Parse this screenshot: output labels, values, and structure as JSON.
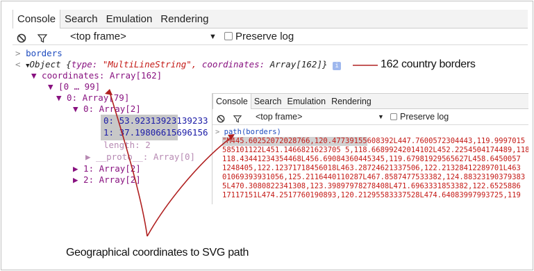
{
  "devtools": {
    "tabs": [
      "Console",
      "Search",
      "Emulation",
      "Rendering"
    ],
    "active_tab": "Console",
    "toolbar": {
      "block_icon": "block-icon",
      "filter_icon": "filter-icon",
      "frame_select": "<top frame>",
      "dropdown_icon": "▼",
      "preserve_log_label": "Preserve log"
    },
    "console": {
      "input_prompt": ">",
      "input_command": "borders",
      "result_arrow": "<",
      "result_expand": "▼",
      "result_object_prefix": "Object {",
      "type_key": "type:",
      "type_value": "\"MultiLineString\",",
      "coords_key": "coordinates:",
      "coords_value": "Array[162]}",
      "info_badge": "i",
      "coordinates_row": "▼ coordinates: Array[162]",
      "range_row": "▼ [0 … 99]",
      "row_0": "▼ 0: Array[79]",
      "row_0_0": "▼ 0: Array[2]",
      "value_0": "0: 53.92313923139233",
      "value_1": "1: 37.19806615696156",
      "length_row": "length: 2",
      "proto_row": "▶ __proto__: Array[0]",
      "row_1": "▶ 1: Array[2]",
      "row_2": "▶ 2: Array[2]"
    }
  },
  "inset": {
    "tabs": [
      "Console",
      "Search",
      "Emulation",
      "Rendering"
    ],
    "active_tab": "Console",
    "toolbar": {
      "frame_select": "<top frame>",
      "dropdown_icon": "▼",
      "preserve_log_label": "Preserve log"
    },
    "console": {
      "input_prompt": ">",
      "input_command": "path(borders)",
      "output_lines": [
        "\"M445.60252072028766,120.47739155608392L447.7600572304443,119.9997015",
        "585101122L451.1466821623705 5,118.66899242014102L452.2254504174489,118",
        "118.43441234354468L456.69084360445345,119.67981929565627L458.6450057",
        "1248405,122.12371718456018L463.28724621337506,122.21328412289701L463",
        "01069393931056,125.2116440110287L467.8587477533382,124.88323190379383",
        "5L470.3080822341308,123.39897978278408L471.6963331853382,122.6525886",
        "17117151L474.2517760190893,120.21295583337528L474.64083997993725,119"
      ]
    }
  },
  "annotations": {
    "borders_callout": "162 country borders",
    "coords_callout": "Geographical coordinates to SVG path"
  },
  "colors": {
    "annotation_stroke": "#b02020",
    "string_red": "#c41a16",
    "keyword_blue": "#1d4bbf",
    "key_purple": "#881280"
  }
}
